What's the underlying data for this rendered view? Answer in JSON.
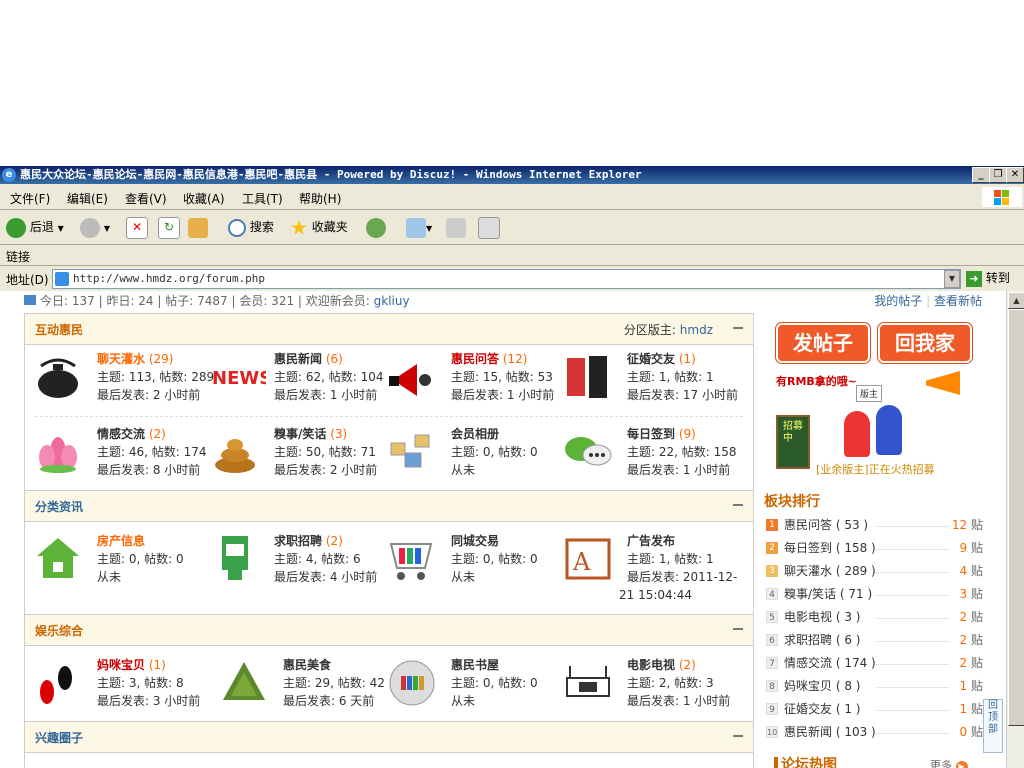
{
  "window": {
    "title": "惠民大众论坛-惠民论坛-惠民网-惠民信息港-惠民吧-惠民县 - Powered by Discuz! - Windows Internet Explorer",
    "minimize": "_",
    "restore": "❐",
    "close": "✕"
  },
  "menu": [
    "文件(F)",
    "编辑(E)",
    "查看(V)",
    "收藏(A)",
    "工具(T)",
    "帮助(H)"
  ],
  "toolbar": {
    "back": "后退",
    "search": "搜索",
    "favorites": "收藏夹"
  },
  "links_label": "链接",
  "address": {
    "label": "地址(D)",
    "url": "http://www.hmdz.org/forum.php",
    "go": "转到"
  },
  "stats": {
    "today": "今日: 137",
    "yesterday": "昨日: 24",
    "posts": "帖子: 7487",
    "members": "会员: 321",
    "welcome_label": "欢迎新会员:",
    "new_member": "gkliuy",
    "my_posts": "我的帖子",
    "new_posts": "查看新帖"
  },
  "sections": [
    {
      "title": "互动惠民",
      "moderator_label": "分区版主:",
      "moderator": "hmdz",
      "forums": [
        {
          "name": "聊天灌水",
          "count": "(29)",
          "l1": "主题: 113, 帖数: 289",
          "l2": "最后发表: 2 小时前",
          "icon": "teapot-icon"
        },
        {
          "name": "惠民新闻",
          "count": "(6)",
          "l1": "主题: 62, 帖数: 104",
          "l2": "最后发表: 1 小时前",
          "icon": "news-icon"
        },
        {
          "name": "惠民问答",
          "count": "(12)",
          "l1": "主题: 15, 帖数: 53",
          "l2": "最后发表: 1 小时前",
          "icon": "megaphone-icon"
        },
        {
          "name": "征婚交友",
          "count": "(1)",
          "l1": "主题: 1, 帖数: 1",
          "l2": "最后发表: 17 小时前",
          "icon": "dating-icon"
        },
        {
          "name": "情感交流",
          "count": "(2)",
          "l1": "主题: 46, 帖数: 174",
          "l2": "最后发表: 8 小时前",
          "icon": "lotus-icon"
        },
        {
          "name": "糗事/笑话",
          "count": "(3)",
          "l1": "主题: 50, 帖数: 71",
          "l2": "最后发表: 2 小时前",
          "icon": "poop-icon"
        },
        {
          "name": "会员相册",
          "count": "",
          "l1": "主题: 0, 帖数: 0",
          "l2": "从未",
          "icon": "photos-icon"
        },
        {
          "name": "每日签到",
          "count": "(9)",
          "l1": "主题: 22, 帖数: 158",
          "l2": "最后发表: 1 小时前",
          "icon": "chat-bubble-icon"
        }
      ]
    },
    {
      "title": "分类资讯",
      "forums": [
        {
          "name": "房产信息",
          "count": "",
          "l1": "主题: 0, 帖数: 0",
          "l2": "从未",
          "icon": "house-icon"
        },
        {
          "name": "求职招聘",
          "count": "(2)",
          "l1": "主题: 4, 帖数: 6",
          "l2": "最后发表: 4 小时前",
          "icon": "job-board-icon"
        },
        {
          "name": "同城交易",
          "count": "",
          "l1": "主题: 0, 帖数: 0",
          "l2": "从未",
          "icon": "cart-icon"
        },
        {
          "name": "广告发布",
          "count": "",
          "l1": "主题: 1, 帖数: 1",
          "l2": "最后发表: 2011-12-",
          "l3": "21 15:04:44",
          "icon": "ad-logo-icon"
        }
      ]
    },
    {
      "title": "娱乐综合",
      "forums": [
        {
          "name": "妈咪宝贝",
          "count": "(1)",
          "l1": "主题: 3, 帖数: 8",
          "l2": "最后发表: 3 小时前",
          "icon": "footprint-icon"
        },
        {
          "name": "惠民美食",
          "count": "",
          "l1": "主题: 29, 帖数: 42",
          "l2": "最后发表: 6 天前",
          "icon": "zongzi-icon"
        },
        {
          "name": "惠民书屋",
          "count": "",
          "l1": "主题: 0, 帖数: 0",
          "l2": "从未",
          "icon": "books-icon"
        },
        {
          "name": "电影电视",
          "count": "(2)",
          "l1": "主题: 2, 帖数: 3",
          "l2": "最后发表: 1 小时前",
          "icon": "tv-icon"
        }
      ]
    },
    {
      "title": "兴趣圈子"
    }
  ],
  "sidebar": {
    "post_button": "发帖子",
    "home_button": "回我家",
    "ad": {
      "top": "有RMB拿的哦~",
      "sign": "招募中",
      "bottom": "[业余版主]正在火热招募",
      "tag": "版主"
    },
    "rank_title": "板块排行",
    "ranks": [
      {
        "num": "1",
        "name": "惠民问答",
        "count": "( 53 )",
        "posts": "12",
        "unit": "贴"
      },
      {
        "num": "2",
        "name": "每日签到",
        "count": "( 158 )",
        "posts": "9",
        "unit": "贴"
      },
      {
        "num": "3",
        "name": "聊天灌水",
        "count": "( 289 )",
        "posts": "4",
        "unit": "贴"
      },
      {
        "num": "4",
        "name": "糗事/笑话",
        "count": "( 71 )",
        "posts": "3",
        "unit": "贴"
      },
      {
        "num": "5",
        "name": "电影电视",
        "count": "( 3 )",
        "posts": "2",
        "unit": "贴"
      },
      {
        "num": "6",
        "name": "求职招聘",
        "count": "( 6 )",
        "posts": "2",
        "unit": "贴"
      },
      {
        "num": "7",
        "name": "情感交流",
        "count": "( 174 )",
        "posts": "2",
        "unit": "贴"
      },
      {
        "num": "8",
        "name": "妈咪宝贝",
        "count": "( 8 )",
        "posts": "1",
        "unit": "贴"
      },
      {
        "num": "9",
        "name": "征婚交友",
        "count": "( 1 )",
        "posts": "1",
        "unit": "贴"
      },
      {
        "num": "10",
        "name": "惠民新闻",
        "count": "( 103 )",
        "posts": "0",
        "unit": "贴"
      }
    ],
    "hot_title": "论坛热图",
    "more": "更多",
    "back_top": "回顶部"
  },
  "colors": {
    "titlebar": "#0a246a",
    "accent_orange": "#ff6600",
    "link_blue": "#336699",
    "button_red": "#f05a28",
    "section_bg": "#fdf8e6"
  }
}
